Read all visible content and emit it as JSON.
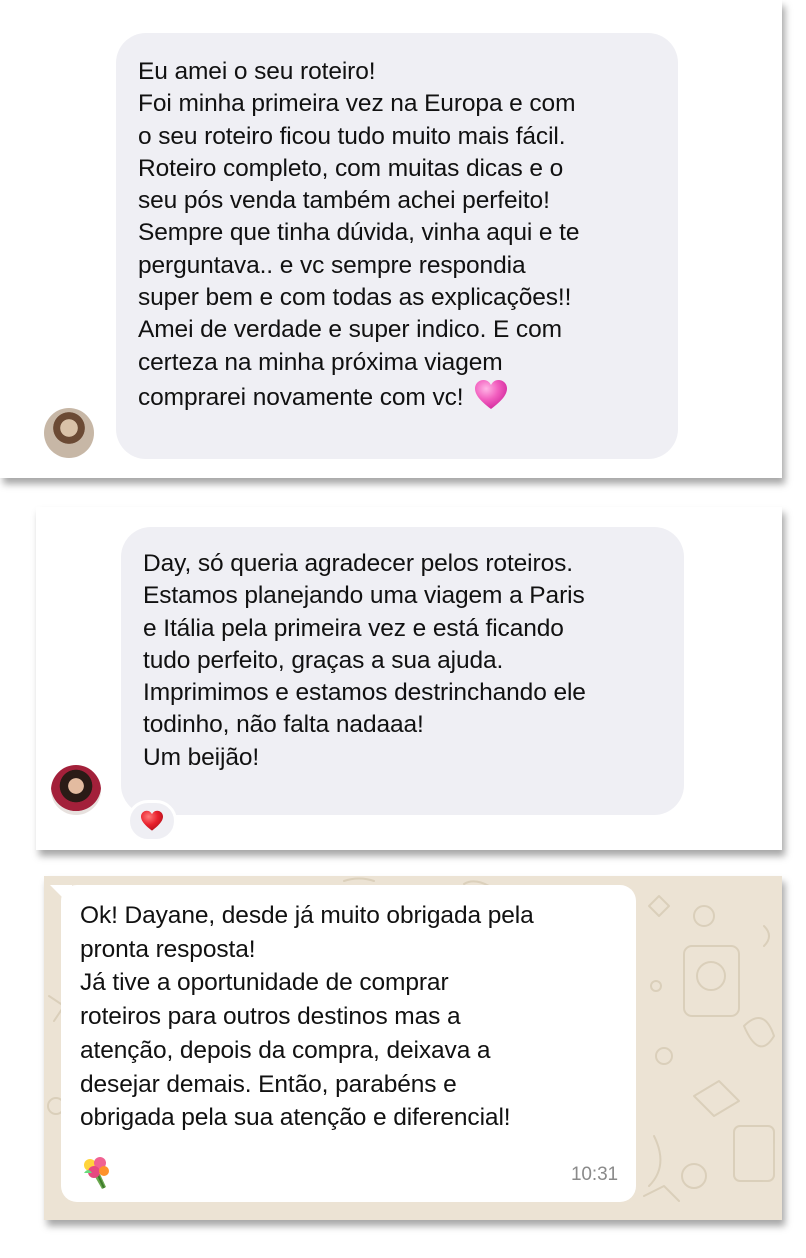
{
  "message1": {
    "lines": [
      "Eu amei o seu roteiro!",
      "Foi minha primeira vez na Europa e com",
      "o seu roteiro ficou tudo muito mais fácil.",
      "Roteiro completo, com muitas dicas e o",
      "seu pós venda também achei perfeito!",
      "Sempre que tinha dúvida, vinha aqui e te",
      "perguntava.. e vc sempre respondia",
      "super bem e com todas as explicações!!",
      "Amei de verdade e super indico. E com",
      "certeza na minha próxima viagem",
      "comprarei novamente com vc!"
    ],
    "emoji": "pink-heart-icon"
  },
  "message2": {
    "lines": [
      "Day, só queria agradecer pelos roteiros.",
      "Estamos planejando uma viagem a Paris",
      "e Itália pela primeira vez e está ficando",
      "tudo perfeito, graças a sua ajuda.",
      "Imprimimos e estamos destrinchando ele",
      "todinho, não falta nadaaa!",
      "Um beijão!"
    ],
    "reaction": "red-heart-icon"
  },
  "message3": {
    "lines": [
      "Ok! Dayane, desde já muito obrigada pela",
      "pronta resposta!",
      "Já tive a oportunidade de comprar",
      "roteiros para outros destinos mas a",
      "atenção, depois da compra, deixava a",
      "desejar demais. Então, parabéns e",
      "obrigada pela sua atenção e diferencial!"
    ],
    "emoji": "bouquet-icon",
    "time": "10:31"
  },
  "colors": {
    "instagram_bubble": "#efeff4",
    "whatsapp_background": "#ece3d4",
    "whatsapp_bubble": "#ffffff",
    "heart_pink": "#f25fbf",
    "heart_red": "#e8202c"
  }
}
